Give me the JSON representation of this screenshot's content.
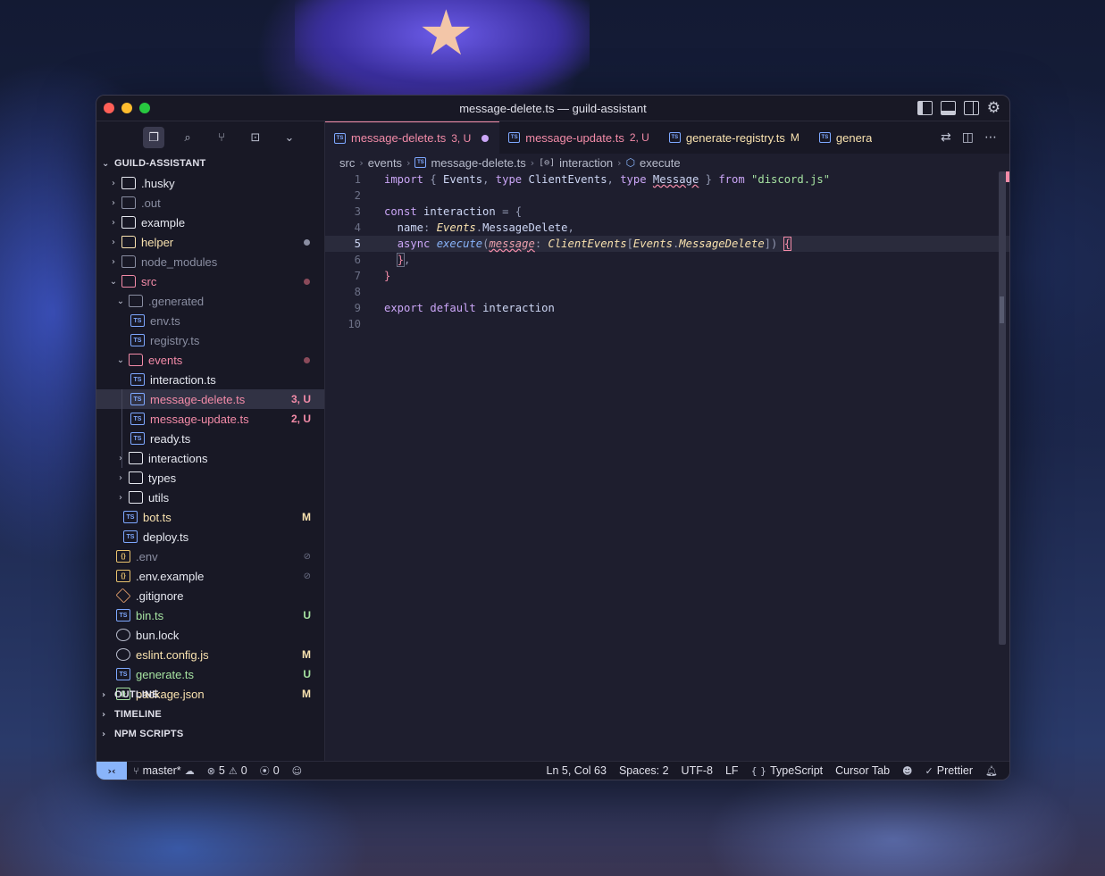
{
  "window": {
    "title": "message-delete.ts — guild-assistant"
  },
  "explorer": {
    "project": "GUILD-ASSISTANT",
    "items": [
      {
        "name": ".husky",
        "kind": "folder",
        "depth": 0,
        "chev": "›",
        "color": "c-white"
      },
      {
        "name": ".out",
        "kind": "folder",
        "depth": 0,
        "chev": "›",
        "color": "c-dim"
      },
      {
        "name": "example",
        "kind": "folder",
        "depth": 0,
        "chev": "›",
        "color": "c-white"
      },
      {
        "name": "helper",
        "kind": "folder",
        "depth": 0,
        "chev": "›",
        "color": "c-yellow",
        "dot": "#8a8ea2"
      },
      {
        "name": "node_modules",
        "kind": "folder",
        "depth": 0,
        "chev": "›",
        "color": "c-dim"
      },
      {
        "name": "src",
        "kind": "folder",
        "depth": 0,
        "chev": "⌄",
        "color": "c-red",
        "dot": "#8a4a5a"
      },
      {
        "name": ".generated",
        "kind": "folder",
        "depth": 1,
        "chev": "⌄",
        "color": "c-dim"
      },
      {
        "name": "env.ts",
        "kind": "ts",
        "depth": 2,
        "color": "c-dim"
      },
      {
        "name": "registry.ts",
        "kind": "ts",
        "depth": 2,
        "color": "c-dim"
      },
      {
        "name": "events",
        "kind": "folder",
        "depth": 1,
        "chev": "⌄",
        "color": "c-red",
        "dot": "#8a4a5a"
      },
      {
        "name": "interaction.ts",
        "kind": "ts",
        "depth": 2,
        "color": "c-white"
      },
      {
        "name": "message-delete.ts",
        "kind": "ts",
        "depth": 2,
        "color": "c-red",
        "badge": "3, U",
        "selected": true
      },
      {
        "name": "message-update.ts",
        "kind": "ts",
        "depth": 2,
        "color": "c-red",
        "badge": "2, U"
      },
      {
        "name": "ready.ts",
        "kind": "ts",
        "depth": 2,
        "color": "c-white"
      },
      {
        "name": "interactions",
        "kind": "folder",
        "depth": 1,
        "chev": "›",
        "color": "c-white"
      },
      {
        "name": "types",
        "kind": "folder",
        "depth": 1,
        "chev": "›",
        "color": "c-white"
      },
      {
        "name": "utils",
        "kind": "folder",
        "depth": 1,
        "chev": "›",
        "color": "c-white"
      },
      {
        "name": "bot.ts",
        "kind": "ts",
        "depth": 1,
        "color": "c-yellow",
        "badge": "M"
      },
      {
        "name": "deploy.ts",
        "kind": "ts",
        "depth": 1,
        "color": "c-white"
      },
      {
        "name": ".env",
        "kind": "env",
        "depth": 0,
        "color": "c-dim",
        "badge": "⊘"
      },
      {
        "name": ".env.example",
        "kind": "env",
        "depth": 0,
        "color": "c-white",
        "badge": "⊘"
      },
      {
        "name": ".gitignore",
        "kind": "git",
        "depth": 0,
        "color": "c-white"
      },
      {
        "name": "bin.ts",
        "kind": "ts",
        "depth": 0,
        "color": "c-green",
        "badge": "U"
      },
      {
        "name": "bun.lock",
        "kind": "round",
        "depth": 0,
        "color": "c-white"
      },
      {
        "name": "eslint.config.js",
        "kind": "round",
        "depth": 0,
        "color": "c-yellow",
        "badge": "M"
      },
      {
        "name": "generate.ts",
        "kind": "ts",
        "depth": 0,
        "color": "c-green",
        "badge": "U"
      },
      {
        "name": "package.json",
        "kind": "json",
        "depth": 0,
        "color": "c-yellow",
        "badge": "M"
      }
    ],
    "sections": [
      "OUTLINE",
      "TIMELINE",
      "NPM SCRIPTS"
    ]
  },
  "tabs": [
    {
      "label": "message-delete.ts",
      "badge": "3, U",
      "active": true,
      "dirty": true,
      "color": "#f38ba8"
    },
    {
      "label": "message-update.ts",
      "badge": "2, U",
      "active": false,
      "color": "#f38ba8"
    },
    {
      "label": "generate-registry.ts",
      "badge": "M",
      "active": false,
      "color": "#f9e2af"
    },
    {
      "label": "genera",
      "badge": "",
      "active": false,
      "color": "#f9e2af"
    }
  ],
  "breadcrumb": {
    "b1": "src",
    "b2": "events",
    "b3": "message-delete.ts",
    "b4": "interaction",
    "b5": "execute"
  },
  "code": {
    "line_numbers": [
      "1",
      "2",
      "3",
      "4",
      "5",
      "6",
      "7",
      "8",
      "9",
      "10"
    ],
    "current_line": "5"
  },
  "status": {
    "branch": "master*",
    "errors": "5",
    "warnings": "0",
    "ports": "0",
    "position": "Ln 5, Col 63",
    "spaces": "Spaces: 2",
    "encoding": "UTF-8",
    "eol": "LF",
    "language": "TypeScript",
    "cursor_tab": "Cursor Tab",
    "prettier": "Prettier"
  }
}
